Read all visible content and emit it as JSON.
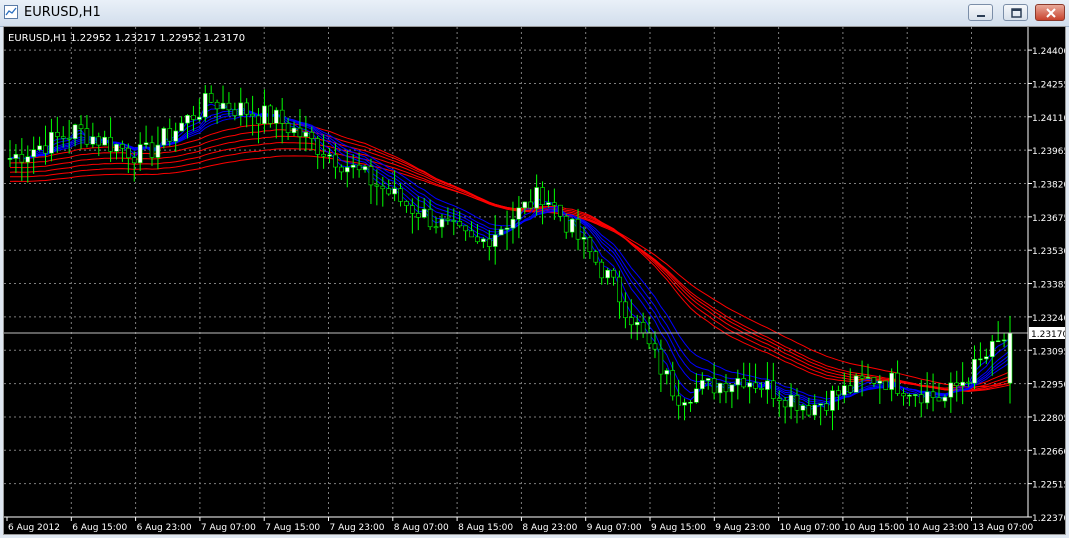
{
  "window": {
    "title": "EURUSD,H1",
    "app_icon": "chart-window-icon",
    "controls": [
      "minimize-icon",
      "restore-icon",
      "close-icon"
    ]
  },
  "chart": {
    "info_line": "EURUSD,H1  1.22952 1.23217 1.22952 1.23170",
    "current_price_label": "1.23170",
    "price_labels": [
      "1.24400",
      "1.24255",
      "1.24110",
      "1.23965",
      "1.23820",
      "1.23675",
      "1.23530",
      "1.23385",
      "1.23240",
      "1.23095",
      "1.22950",
      "1.22805",
      "1.22660",
      "1.22515",
      "1.22370"
    ],
    "time_labels": [
      "6 Aug 2012",
      "6 Aug 15:00",
      "6 Aug 23:00",
      "7 Aug 07:00",
      "7 Aug 15:00",
      "7 Aug 23:00",
      "8 Aug 07:00",
      "8 Aug 15:00",
      "8 Aug 23:00",
      "9 Aug 07:00",
      "9 Aug 15:00",
      "9 Aug 23:00",
      "10 Aug 07:00",
      "10 Aug 15:00",
      "10 Aug 23:00",
      "13 Aug 07:00"
    ],
    "colors": {
      "background": "#000000",
      "grid": "#7f7f7f",
      "bull_candle": "#ffffff",
      "bear_candle": "#000000",
      "wick": "#00ff00",
      "fast_ma": "#0000ff",
      "slow_ma": "#ff0000",
      "text": "#ffffff"
    }
  },
  "chart_data": {
    "type": "candlestick",
    "symbol": "EURUSD",
    "timeframe": "H1",
    "ylim": [
      1.2237,
      1.2447
    ],
    "last_bar": {
      "open": 1.22952,
      "high": 1.23217,
      "low": 1.22952,
      "close": 1.2317
    },
    "close_path": [
      [
        "6 Aug 2012",
        1.2393
      ],
      [
        "6 Aug 15:00",
        1.2405
      ],
      [
        "6 Aug 23:00",
        1.2394
      ],
      [
        "7 Aug 07:00",
        1.2418
      ],
      [
        "7 Aug 15:00",
        1.241
      ],
      [
        "7 Aug 23:00",
        1.2391
      ],
      [
        "8 Aug 07:00",
        1.2372
      ],
      [
        "8 Aug 15:00",
        1.2355
      ],
      [
        "8 Aug 23:00",
        1.2378
      ],
      [
        "9 Aug 07:00",
        1.234
      ],
      [
        "9 Aug 15:00",
        1.229
      ],
      [
        "9 Aug 23:00",
        1.2298
      ],
      [
        "10 Aug 07:00",
        1.2285
      ],
      [
        "10 Aug 15:00",
        1.2298
      ],
      [
        "10 Aug 23:00",
        1.2288
      ],
      [
        "13 Aug 07:00",
        1.2317
      ]
    ]
  }
}
